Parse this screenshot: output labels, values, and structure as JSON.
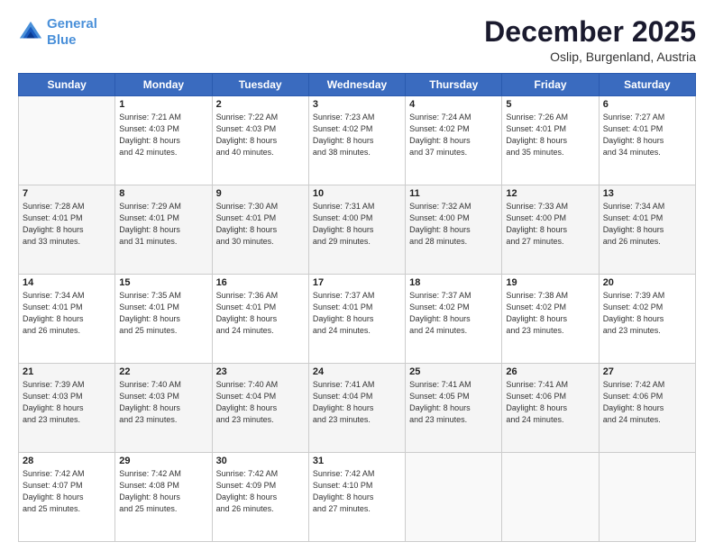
{
  "logo": {
    "line1": "General",
    "line2": "Blue"
  },
  "title": "December 2025",
  "location": "Oslip, Burgenland, Austria",
  "days_of_week": [
    "Sunday",
    "Monday",
    "Tuesday",
    "Wednesday",
    "Thursday",
    "Friday",
    "Saturday"
  ],
  "weeks": [
    [
      {
        "day": "",
        "info": ""
      },
      {
        "day": "1",
        "info": "Sunrise: 7:21 AM\nSunset: 4:03 PM\nDaylight: 8 hours\nand 42 minutes."
      },
      {
        "day": "2",
        "info": "Sunrise: 7:22 AM\nSunset: 4:03 PM\nDaylight: 8 hours\nand 40 minutes."
      },
      {
        "day": "3",
        "info": "Sunrise: 7:23 AM\nSunset: 4:02 PM\nDaylight: 8 hours\nand 38 minutes."
      },
      {
        "day": "4",
        "info": "Sunrise: 7:24 AM\nSunset: 4:02 PM\nDaylight: 8 hours\nand 37 minutes."
      },
      {
        "day": "5",
        "info": "Sunrise: 7:26 AM\nSunset: 4:01 PM\nDaylight: 8 hours\nand 35 minutes."
      },
      {
        "day": "6",
        "info": "Sunrise: 7:27 AM\nSunset: 4:01 PM\nDaylight: 8 hours\nand 34 minutes."
      }
    ],
    [
      {
        "day": "7",
        "info": "Sunrise: 7:28 AM\nSunset: 4:01 PM\nDaylight: 8 hours\nand 33 minutes."
      },
      {
        "day": "8",
        "info": "Sunrise: 7:29 AM\nSunset: 4:01 PM\nDaylight: 8 hours\nand 31 minutes."
      },
      {
        "day": "9",
        "info": "Sunrise: 7:30 AM\nSunset: 4:01 PM\nDaylight: 8 hours\nand 30 minutes."
      },
      {
        "day": "10",
        "info": "Sunrise: 7:31 AM\nSunset: 4:00 PM\nDaylight: 8 hours\nand 29 minutes."
      },
      {
        "day": "11",
        "info": "Sunrise: 7:32 AM\nSunset: 4:00 PM\nDaylight: 8 hours\nand 28 minutes."
      },
      {
        "day": "12",
        "info": "Sunrise: 7:33 AM\nSunset: 4:00 PM\nDaylight: 8 hours\nand 27 minutes."
      },
      {
        "day": "13",
        "info": "Sunrise: 7:34 AM\nSunset: 4:01 PM\nDaylight: 8 hours\nand 26 minutes."
      }
    ],
    [
      {
        "day": "14",
        "info": "Sunrise: 7:34 AM\nSunset: 4:01 PM\nDaylight: 8 hours\nand 26 minutes."
      },
      {
        "day": "15",
        "info": "Sunrise: 7:35 AM\nSunset: 4:01 PM\nDaylight: 8 hours\nand 25 minutes."
      },
      {
        "day": "16",
        "info": "Sunrise: 7:36 AM\nSunset: 4:01 PM\nDaylight: 8 hours\nand 24 minutes."
      },
      {
        "day": "17",
        "info": "Sunrise: 7:37 AM\nSunset: 4:01 PM\nDaylight: 8 hours\nand 24 minutes."
      },
      {
        "day": "18",
        "info": "Sunrise: 7:37 AM\nSunset: 4:02 PM\nDaylight: 8 hours\nand 24 minutes."
      },
      {
        "day": "19",
        "info": "Sunrise: 7:38 AM\nSunset: 4:02 PM\nDaylight: 8 hours\nand 23 minutes."
      },
      {
        "day": "20",
        "info": "Sunrise: 7:39 AM\nSunset: 4:02 PM\nDaylight: 8 hours\nand 23 minutes."
      }
    ],
    [
      {
        "day": "21",
        "info": "Sunrise: 7:39 AM\nSunset: 4:03 PM\nDaylight: 8 hours\nand 23 minutes."
      },
      {
        "day": "22",
        "info": "Sunrise: 7:40 AM\nSunset: 4:03 PM\nDaylight: 8 hours\nand 23 minutes."
      },
      {
        "day": "23",
        "info": "Sunrise: 7:40 AM\nSunset: 4:04 PM\nDaylight: 8 hours\nand 23 minutes."
      },
      {
        "day": "24",
        "info": "Sunrise: 7:41 AM\nSunset: 4:04 PM\nDaylight: 8 hours\nand 23 minutes."
      },
      {
        "day": "25",
        "info": "Sunrise: 7:41 AM\nSunset: 4:05 PM\nDaylight: 8 hours\nand 23 minutes."
      },
      {
        "day": "26",
        "info": "Sunrise: 7:41 AM\nSunset: 4:06 PM\nDaylight: 8 hours\nand 24 minutes."
      },
      {
        "day": "27",
        "info": "Sunrise: 7:42 AM\nSunset: 4:06 PM\nDaylight: 8 hours\nand 24 minutes."
      }
    ],
    [
      {
        "day": "28",
        "info": "Sunrise: 7:42 AM\nSunset: 4:07 PM\nDaylight: 8 hours\nand 25 minutes."
      },
      {
        "day": "29",
        "info": "Sunrise: 7:42 AM\nSunset: 4:08 PM\nDaylight: 8 hours\nand 25 minutes."
      },
      {
        "day": "30",
        "info": "Sunrise: 7:42 AM\nSunset: 4:09 PM\nDaylight: 8 hours\nand 26 minutes."
      },
      {
        "day": "31",
        "info": "Sunrise: 7:42 AM\nSunset: 4:10 PM\nDaylight: 8 hours\nand 27 minutes."
      },
      {
        "day": "",
        "info": ""
      },
      {
        "day": "",
        "info": ""
      },
      {
        "day": "",
        "info": ""
      }
    ]
  ]
}
